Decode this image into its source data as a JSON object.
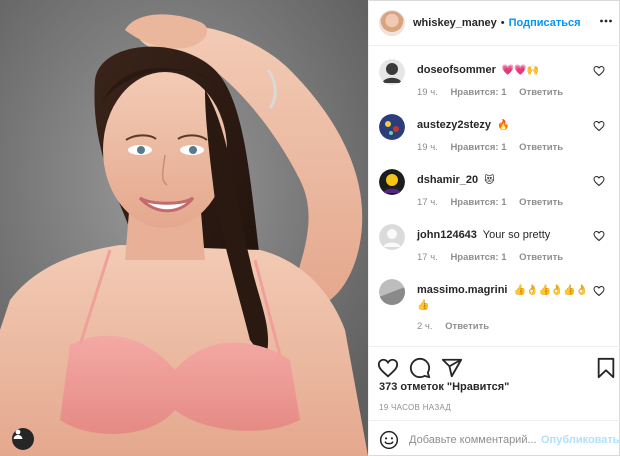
{
  "post": {
    "author": "whiskey_maney",
    "follow_label": "Подписаться",
    "separator": "•",
    "more_icon": "more-horizontal-icon",
    "photo_description_icon": "user-tag-icon"
  },
  "comments": [
    {
      "user": "doseofsommer",
      "text": "",
      "emojis": [
        "💗",
        "💗",
        "🙌"
      ],
      "time": "19 ч.",
      "likes": "Нравится: 1",
      "reply": "Ответить",
      "avatar_color": "#3a3a3a"
    },
    {
      "user": "austezy2stezy",
      "text": "",
      "emojis": [
        "🔥"
      ],
      "time": "19 ч.",
      "likes": "Нравится: 1",
      "reply": "Ответить",
      "avatar_color": "#2b3d7a"
    },
    {
      "user": "dshamir_20",
      "text": "",
      "emojis": [
        "😻"
      ],
      "time": "17 ч.",
      "likes": "Нравится: 1",
      "reply": "Ответить",
      "avatar_color": "#1d1d1d"
    },
    {
      "user": "john124643",
      "text": "Your so pretty",
      "emojis": [],
      "time": "17 ч.",
      "likes": "Нравится: 1",
      "reply": "Ответить",
      "avatar_color": "#dbdbdb"
    },
    {
      "user": "massimo.magrini",
      "text": "",
      "emojis": [
        "👍",
        "👌",
        "👍",
        "👌",
        "👍",
        "👌",
        "👍"
      ],
      "time": "2 ч.",
      "likes": "",
      "reply": "Ответить",
      "avatar_color": "#9a9a9a"
    }
  ],
  "actions": {
    "like_icon": "heart-icon",
    "comment_icon": "comment-icon",
    "share_icon": "send-icon",
    "save_icon": "bookmark-icon",
    "likes_count": "373 отметок \"Нравится\"",
    "timestamp": "19 ЧАСОВ НАЗАД"
  },
  "comment_box": {
    "placeholder": "Добавьте комментарий...",
    "publish_label": "Опубликовать"
  },
  "colors": {
    "link_blue": "#0095f6",
    "muted": "#8e8e8e",
    "publish_disabled": "#b2dffc"
  }
}
